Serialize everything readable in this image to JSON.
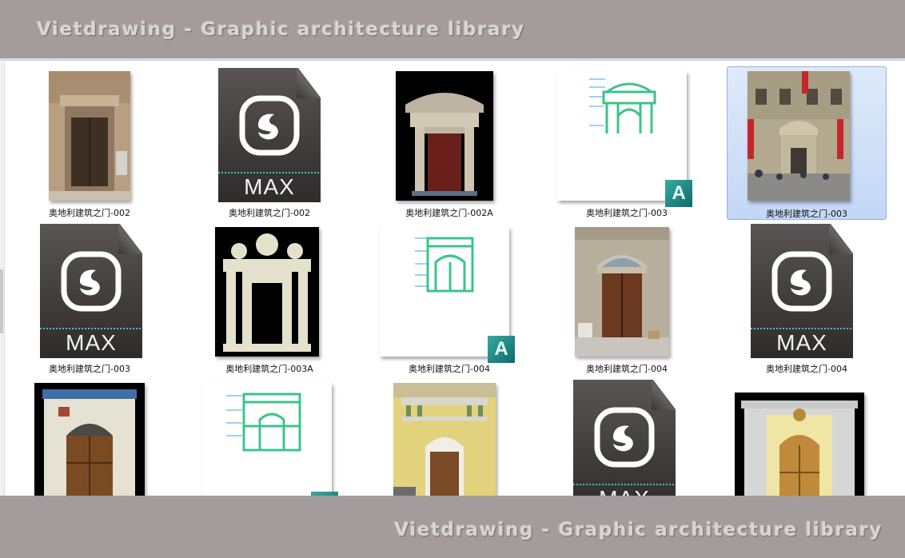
{
  "watermark": {
    "top": "Vietdrawing - Graphic architecture library",
    "bottom": "Vietdrawing - Graphic architecture library"
  },
  "icons": {
    "max_label": "MAX",
    "autocad_badge": "A"
  },
  "files": [
    {
      "name": "奥地利建筑之门-002",
      "type": "photo",
      "icon": "photo-thumbnail"
    },
    {
      "name": "奥地利建筑之门-002",
      "type": "max",
      "icon": "3dsmax-file-icon"
    },
    {
      "name": "奥地利建筑之门-002A",
      "type": "render",
      "icon": "render-thumbnail"
    },
    {
      "name": "奥地利建筑之门-003",
      "type": "dwg",
      "icon": "autocad-file-icon"
    },
    {
      "name": "奥地利建筑之门-003",
      "type": "photo",
      "icon": "photo-thumbnail",
      "selected": true
    },
    {
      "name": "奥地利建筑之门-003",
      "type": "max",
      "icon": "3dsmax-file-icon"
    },
    {
      "name": "奥地利建筑之门-003A",
      "type": "render",
      "icon": "render-thumbnail"
    },
    {
      "name": "奥地利建筑之门-004",
      "type": "dwg",
      "icon": "autocad-file-icon"
    },
    {
      "name": "奥地利建筑之门-004",
      "type": "photo",
      "icon": "photo-thumbnail"
    },
    {
      "name": "奥地利建筑之门-004",
      "type": "max",
      "icon": "3dsmax-file-icon"
    },
    {
      "name": "",
      "type": "render",
      "icon": "render-thumbnail"
    },
    {
      "name": "",
      "type": "dwg",
      "icon": "autocad-file-icon"
    },
    {
      "name": "",
      "type": "photo",
      "icon": "photo-thumbnail"
    },
    {
      "name": "",
      "type": "max",
      "icon": "3dsmax-file-icon"
    },
    {
      "name": "",
      "type": "render",
      "icon": "render-thumbnail"
    }
  ],
  "colors": {
    "banner": "#a49c9c",
    "selection": "#c3d7f5",
    "cad_green": "#3cc48a",
    "cad_blue": "#38a8d8"
  }
}
